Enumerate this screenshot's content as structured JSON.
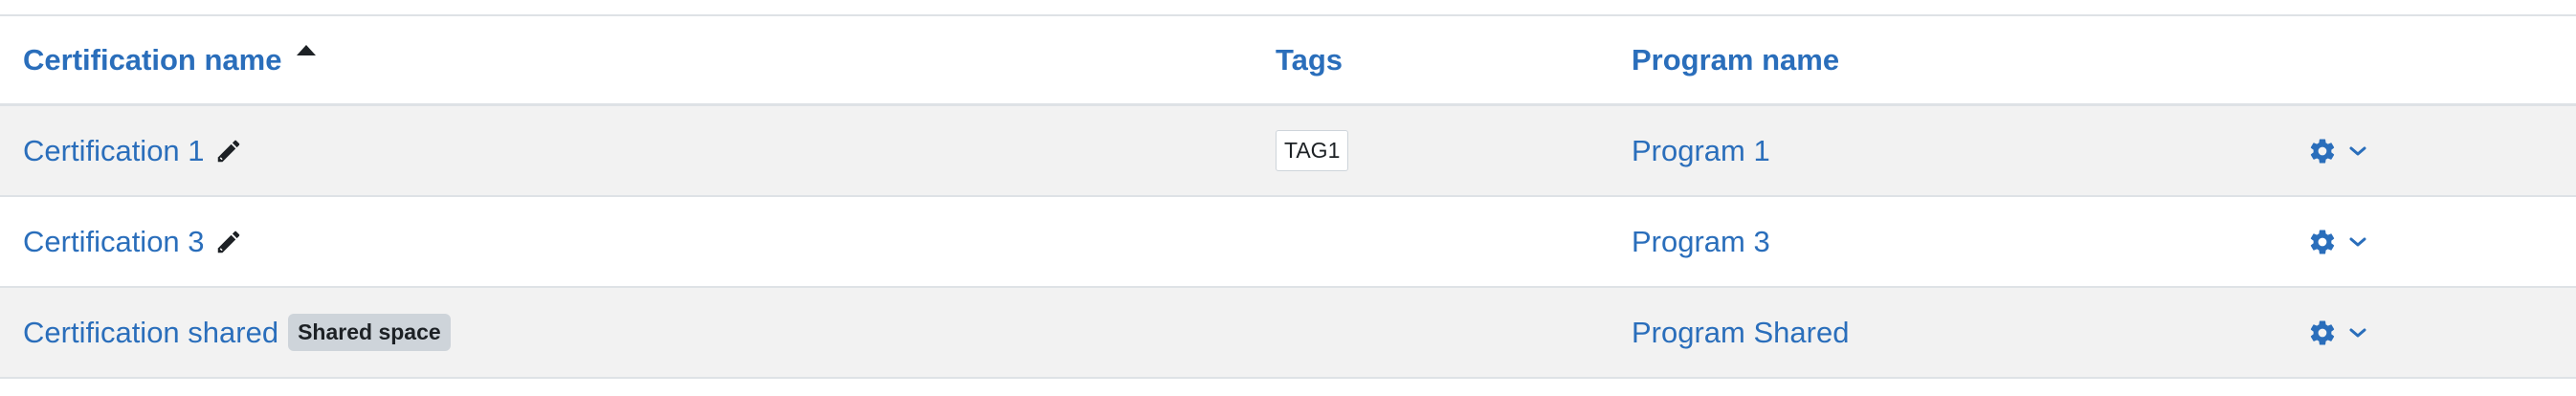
{
  "table": {
    "headers": {
      "certification_name": "Certification name",
      "tags": "Tags",
      "program_name": "Program name"
    },
    "sort": {
      "column": "certification_name",
      "direction": "ascending"
    },
    "rows": [
      {
        "certification": "Certification 1",
        "editable": true,
        "tag": "TAG1",
        "badge": "",
        "program": "Program 1"
      },
      {
        "certification": "Certification 3",
        "editable": true,
        "tag": "",
        "badge": "",
        "program": "Program 3"
      },
      {
        "certification": "Certification shared",
        "editable": false,
        "tag": "",
        "badge": "Shared space",
        "program": "Program Shared"
      }
    ]
  },
  "icons": {
    "sort": "sort-ascending-icon",
    "edit": "pencil-icon",
    "actions": "gear-icon",
    "dropdown": "chevron-down-icon"
  },
  "colors": {
    "link": "#2a6ebb",
    "row_stripe": "#f2f2f2",
    "border": "#dee2e6",
    "badge_bg": "#ced4da",
    "text": "#1d2125"
  }
}
